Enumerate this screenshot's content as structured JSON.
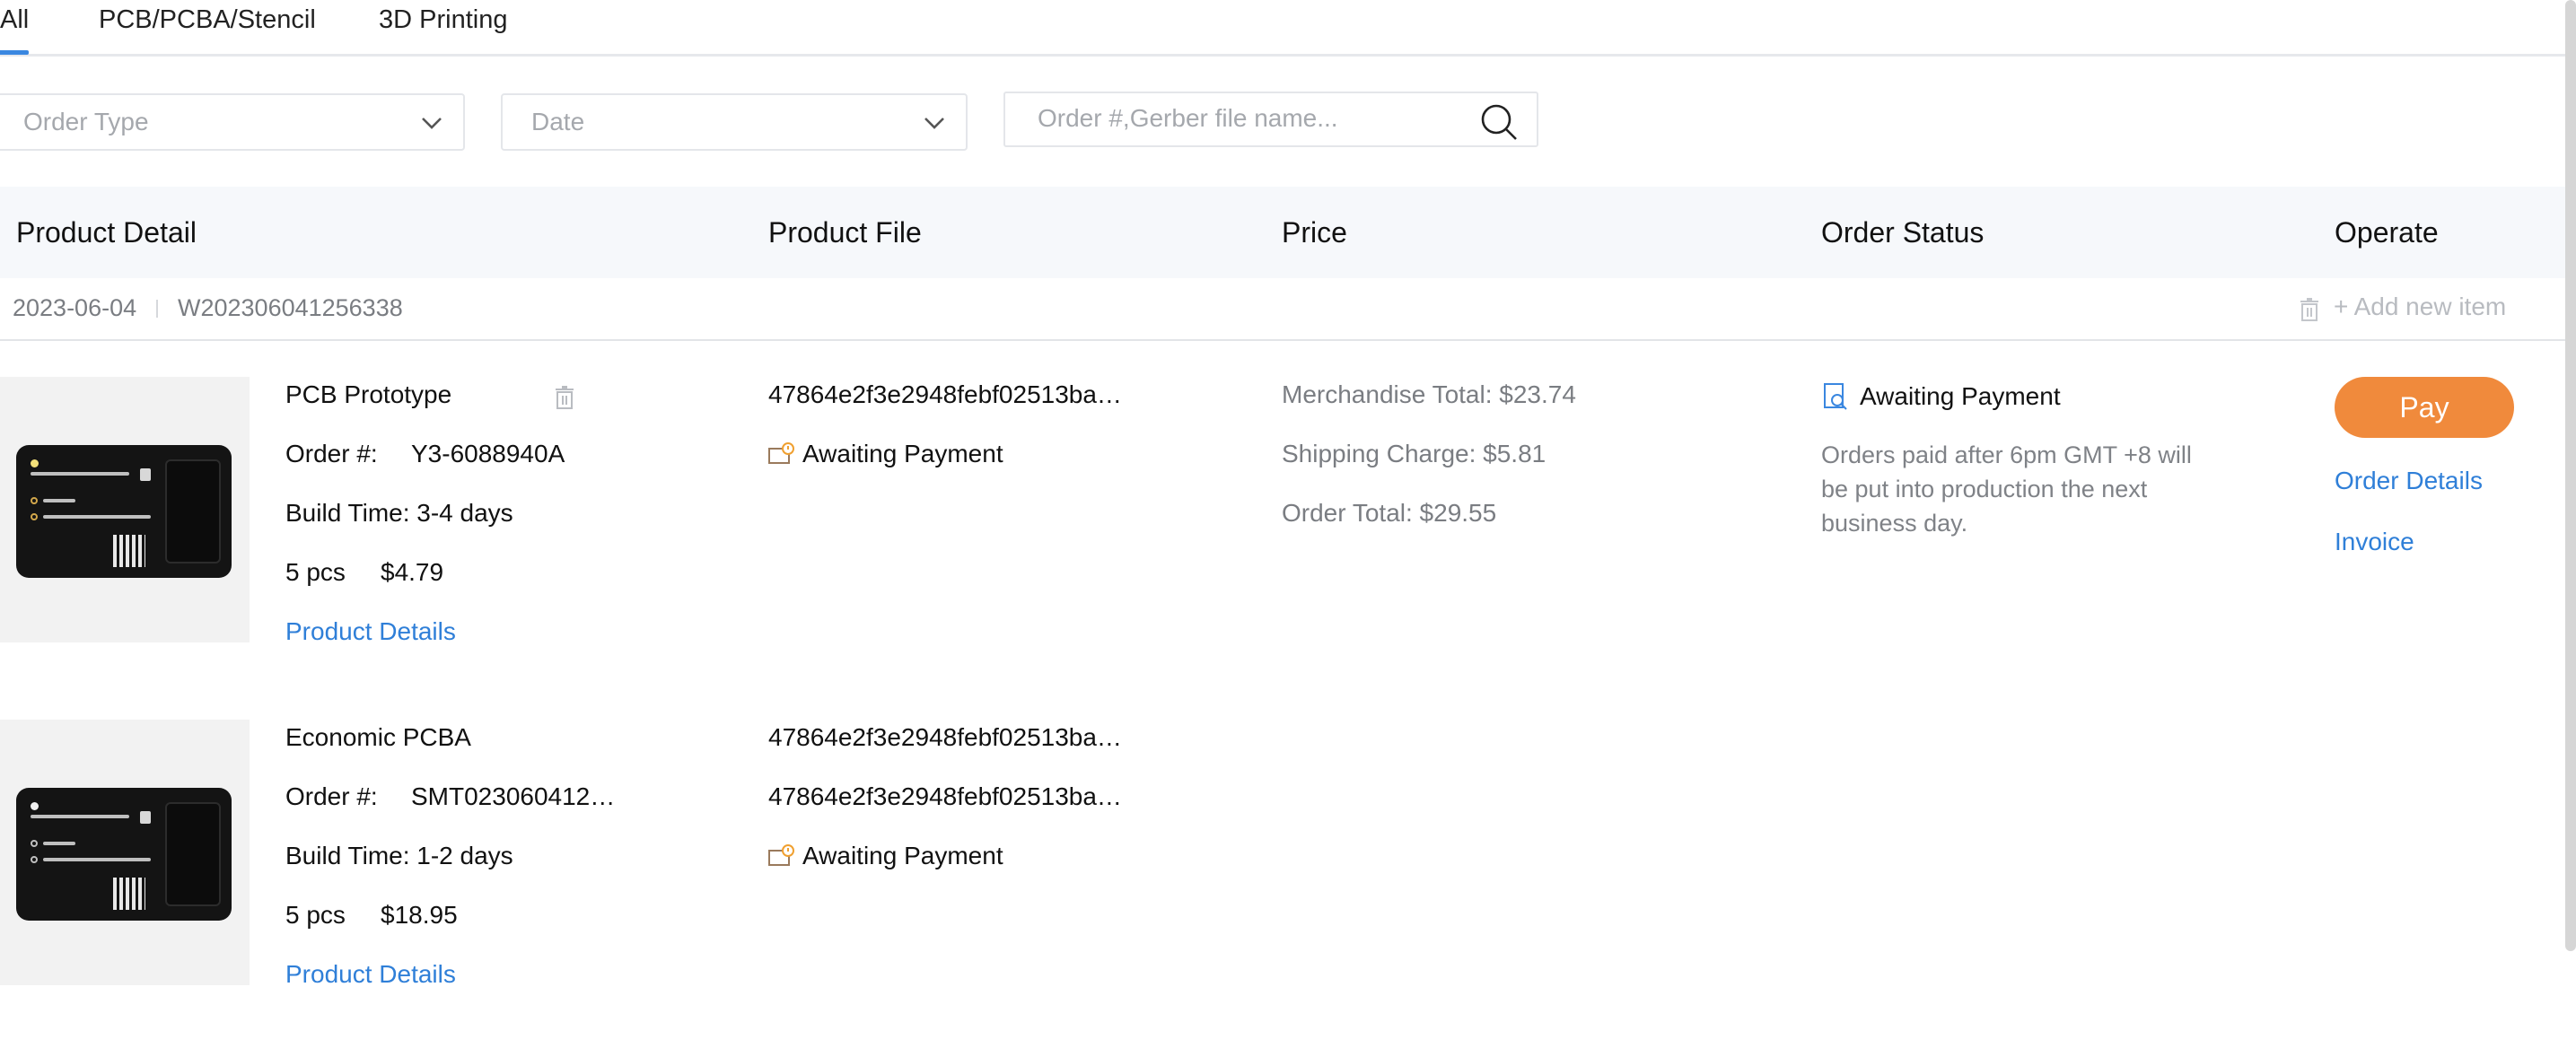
{
  "tabs": [
    "All",
    "PCB/PCBA/Stencil",
    "3D Printing"
  ],
  "filters": {
    "order_type_placeholder": "Order Type",
    "date_placeholder": "Date",
    "search_placeholder": "Order #,Gerber file name..."
  },
  "table": {
    "headers": [
      "Product Detail",
      "Product File",
      "Price",
      "Order Status",
      "Operate"
    ]
  },
  "order": {
    "date": "2023-06-04",
    "number": "W202306041256338",
    "add_item": "+ Add new item",
    "status": "Awaiting Payment",
    "status_note": "Orders paid after 6pm GMT +8 will be put into production the next business day.",
    "price": {
      "merchandise_total": "Merchandise Total: $23.74",
      "shipping_charge": "Shipping Charge: $5.81",
      "order_total": "Order Total: $29.55"
    },
    "operate": {
      "pay": "Pay",
      "order_details": "Order Details",
      "invoice": "Invoice"
    },
    "items": [
      {
        "name": "PCB Prototype",
        "order_label": "Order #:",
        "order_no": "Y3-6088940A",
        "build_time": "Build Time: 3-4 days",
        "qty": "5 pcs",
        "price": "$4.79",
        "details_link": "Product Details",
        "files": [
          "47864e2f3e2948febf02513ba…"
        ],
        "file_status": "Awaiting Payment"
      },
      {
        "name": "Economic PCBA",
        "order_label": "Order #:",
        "order_no": "SMT023060412…",
        "build_time": "Build Time: 1-2 days",
        "qty": "5 pcs",
        "price": "$18.95",
        "details_link": "Product Details",
        "files": [
          "47864e2f3e2948febf02513ba…",
          "47864e2f3e2948febf02513ba…"
        ],
        "file_status": "Awaiting Payment"
      }
    ]
  }
}
